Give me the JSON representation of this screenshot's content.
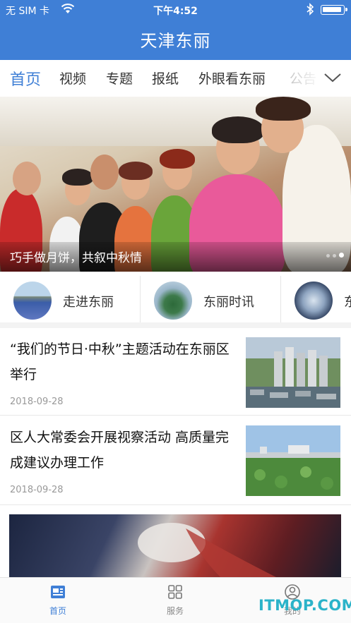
{
  "status_bar": {
    "carrier": "无 SIM 卡",
    "time": "下午4:52",
    "icons": [
      "wifi-icon",
      "bluetooth-icon",
      "battery-icon"
    ]
  },
  "header": {
    "title": "天津东丽"
  },
  "tabs": [
    {
      "label": "首页",
      "active": true
    },
    {
      "label": "视频"
    },
    {
      "label": "专题"
    },
    {
      "label": "报纸"
    },
    {
      "label": "外眼看东丽"
    },
    {
      "label": "公告"
    }
  ],
  "tabs_more_icon": "chevron-down-icon",
  "hero": {
    "caption": "巧手做月饼，共叙中秋情",
    "page_count": 2,
    "current_page": 2
  },
  "quick_links": [
    {
      "label": "走进东丽"
    },
    {
      "label": "东丽时讯"
    },
    {
      "label": "东"
    }
  ],
  "news": [
    {
      "title": "“我们的节日·中秋”主题活动在东丽区举行",
      "date": "2018-09-28"
    },
    {
      "title": "区人大常委会开展视察活动 高质量完成建议办理工作",
      "date": "2018-09-28"
    }
  ],
  "bottom_nav": [
    {
      "label": "首页",
      "icon": "news-icon",
      "active": true
    },
    {
      "label": "服务",
      "icon": "grid-icon"
    },
    {
      "label": "我的",
      "icon": "profile-icon"
    }
  ],
  "watermark": "ITMOP.COM",
  "colors": {
    "brand_blue": "#3f7fd6",
    "watermark": "#2bb3c9"
  }
}
